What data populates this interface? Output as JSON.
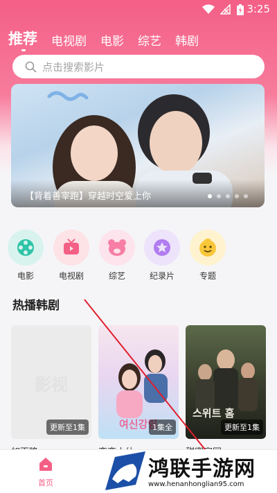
{
  "status_bar": {
    "time": "3:25"
  },
  "tabs": [
    {
      "label": "推荐",
      "active": true
    },
    {
      "label": "电视剧"
    },
    {
      "label": "电影"
    },
    {
      "label": "综艺"
    },
    {
      "label": "韩剧"
    }
  ],
  "search": {
    "placeholder": "点击搜索影片",
    "icon": "search-icon"
  },
  "banner": {
    "caption": "【背着善宰跑】穿越时空爱上你",
    "slide_count": 5,
    "active_slide": 1
  },
  "categories": [
    {
      "label": "电影",
      "icon": "film-reel-icon",
      "bg": "#d8f3ee",
      "fg": "#2ec4a7"
    },
    {
      "label": "电视剧",
      "icon": "tv-icon",
      "bg": "#fde2e6",
      "fg": "#f45f86"
    },
    {
      "label": "综艺",
      "icon": "bear-icon",
      "bg": "#fde3ec",
      "fg": "#f77ea5"
    },
    {
      "label": "纪录片",
      "icon": "star-icon",
      "bg": "#ede3fb",
      "fg": "#b07cf0"
    },
    {
      "label": "专题",
      "icon": "smiley-icon",
      "bg": "#fff3cf",
      "fg": "#f9c73a"
    }
  ],
  "section": {
    "title": "热播韩剧"
  },
  "posters": [
    {
      "badge": "更新至1集",
      "placeholder_text": "影视",
      "title": "如雨降"
    },
    {
      "badge": "1集全",
      "title": "恋恋小仙",
      "art_text": "여신강림"
    },
    {
      "badge": "更新至1集",
      "title": "甜蜜家园",
      "art_text": "스위트 홈"
    }
  ],
  "bottom_nav": {
    "home_label": "首页"
  },
  "watermark": {
    "name": "鸿联手游网",
    "url": "www.henanhonglian95.com"
  },
  "colors": {
    "accent": "#f45f86",
    "background": "#f5f5f7"
  }
}
